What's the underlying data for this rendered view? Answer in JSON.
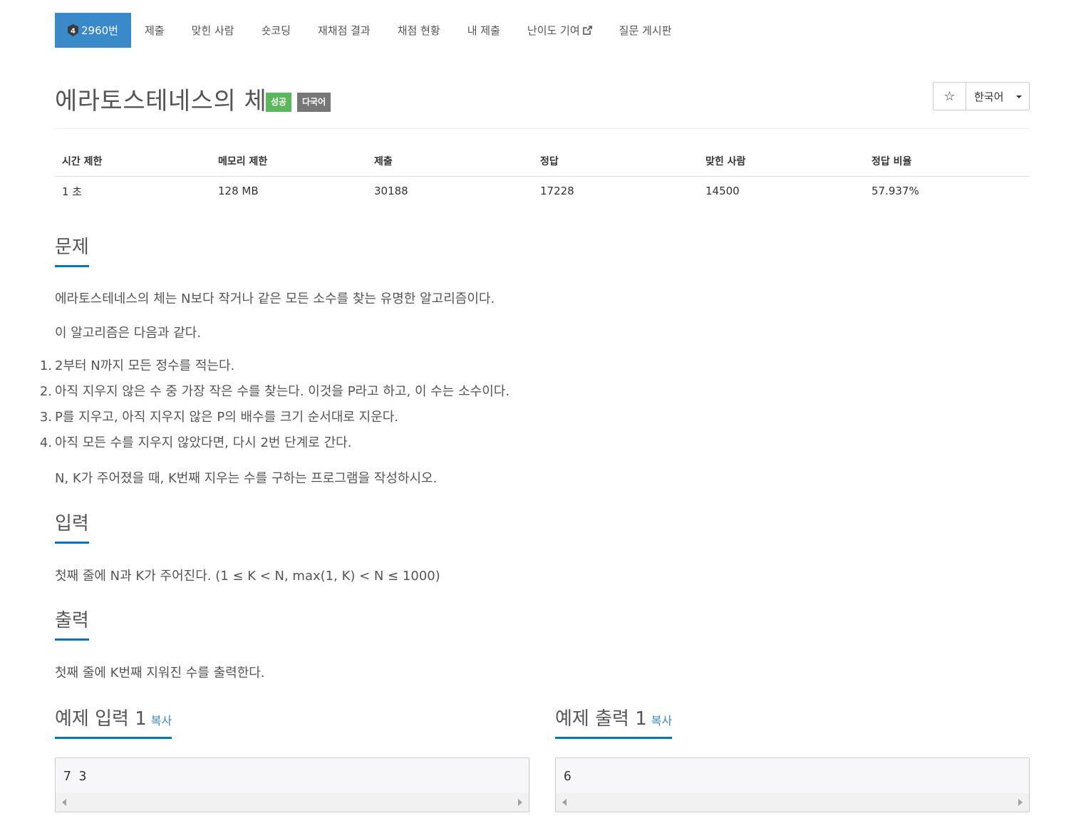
{
  "nav": {
    "tier": "4",
    "items": [
      {
        "label": "2960번"
      },
      {
        "label": "제출"
      },
      {
        "label": "맞힌 사람"
      },
      {
        "label": "숏코딩"
      },
      {
        "label": "재채점 결과"
      },
      {
        "label": "채점 현황"
      },
      {
        "label": "내 제출"
      },
      {
        "label": "난이도 기여"
      },
      {
        "label": "질문 게시판"
      }
    ]
  },
  "problem": {
    "title": "에라토스테네스의 체",
    "labels": [
      "성공",
      "다국어"
    ],
    "star_icon": "☆",
    "language": "한국어"
  },
  "info": {
    "headers": [
      "시간 제한",
      "메모리 제한",
      "제출",
      "정답",
      "맞힌 사람",
      "정답 비율"
    ],
    "values": [
      "1 초",
      "128 MB",
      "30188",
      "17228",
      "14500",
      "57.937%"
    ]
  },
  "sections": {
    "description": {
      "title": "문제",
      "paragraphs": [
        "에라토스테네스의 체는 N보다 작거나 같은 모든 소수를 찾는 유명한 알고리즘이다.",
        "이 알고리즘은 다음과 같다."
      ],
      "steps": [
        "2부터 N까지 모든 정수를 적는다.",
        "아직 지우지 않은 수 중 가장 작은 수를 찾는다. 이것을 P라고 하고, 이 수는 소수이다.",
        "P를 지우고, 아직 지우지 않은 P의 배수를 크기 순서대로 지운다.",
        "아직 모든 수를 지우지 않았다면, 다시 2번 단계로 간다."
      ],
      "closing": "N, K가 주어졌을 때, K번째 지우는 수를 구하는 프로그램을 작성하시오."
    },
    "input": {
      "title": "입력",
      "text": "첫째 줄에 N과 K가 주어진다. (1 ≤ K < N, max(1, K) < N ≤ 1000)"
    },
    "output": {
      "title": "출력",
      "text": "첫째 줄에 K번째 지워진 수를 출력한다."
    },
    "samples": {
      "input_title": "예제 입력 1",
      "output_title": "예제 출력 1",
      "copy_label": "복사",
      "input_value": "7 3",
      "output_value": "6"
    }
  },
  "colors": {
    "primary": "#3a89c9",
    "success": "#5cb85c",
    "neutral": "#777777",
    "section_underline": "#0076c0"
  }
}
